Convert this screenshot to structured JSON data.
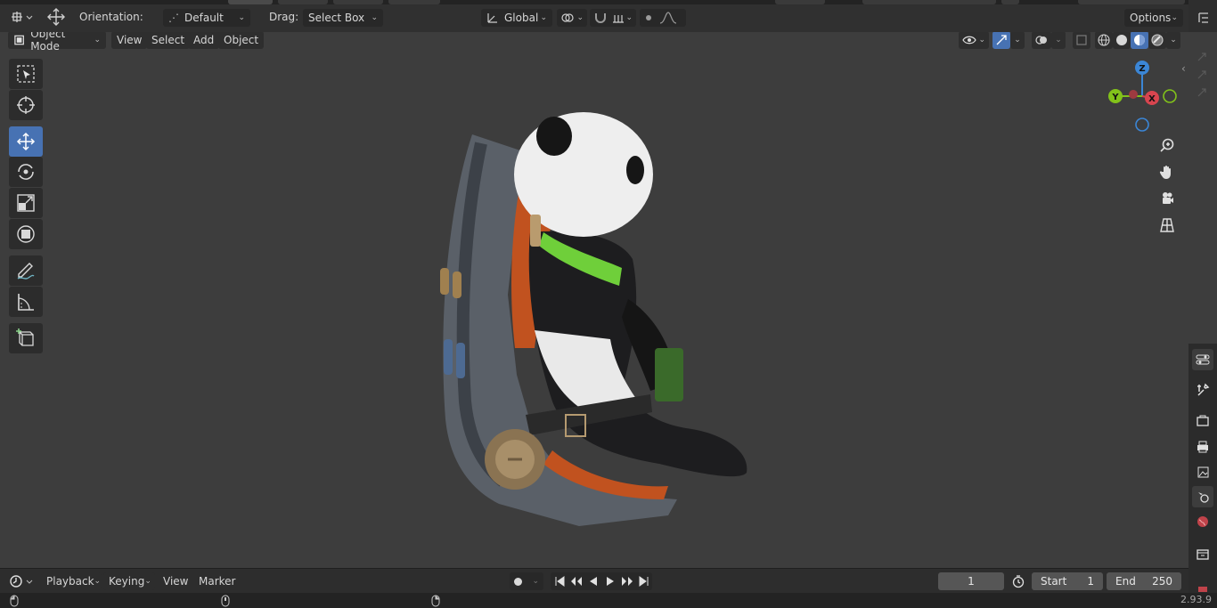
{
  "header": {
    "orientation_label": "Orientation:",
    "orientation_value": "Default",
    "drag_label": "Drag:",
    "drag_value": "Select Box",
    "transform_space": "Global",
    "options_label": "Options"
  },
  "viewport_header": {
    "mode": "Object Mode",
    "menus": [
      "View",
      "Select",
      "Add",
      "Object"
    ]
  },
  "gizmo": {
    "x": "X",
    "y": "Y",
    "z": "Z"
  },
  "toolbar": {
    "tools": [
      "select-box",
      "cursor",
      "move",
      "rotate",
      "scale",
      "transform",
      "annotate",
      "measure",
      "add-cube"
    ],
    "active_tool": "move"
  },
  "timeline": {
    "menus": [
      "Playback",
      "Keying",
      "View",
      "Marker"
    ],
    "current_frame": "1",
    "start_label": "Start",
    "start_value": "1",
    "end_label": "End",
    "end_value": "250"
  },
  "status": {
    "version": "2.93.9"
  },
  "colors": {
    "accent": "#4772b3",
    "x_axis": "#d8454f",
    "y_axis": "#82c21a",
    "z_axis": "#3b86d6"
  }
}
